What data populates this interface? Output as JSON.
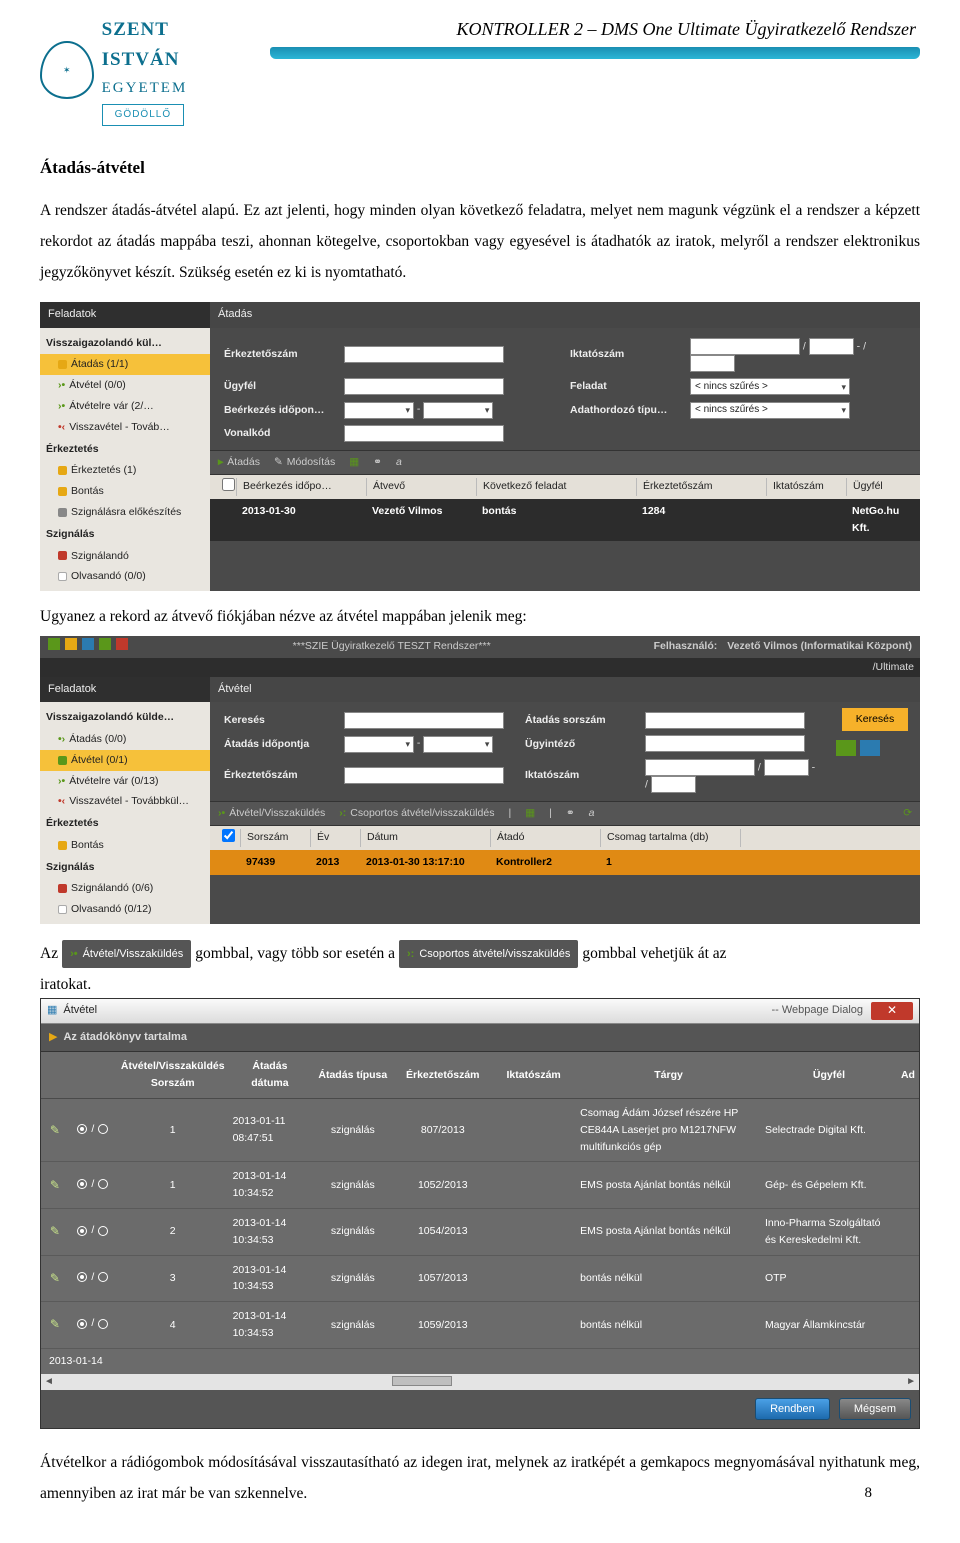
{
  "header": {
    "title": "KONTROLLER 2 – DMS One Ultimate Ügyiratkezelő Rendszer",
    "logo_line1": "SZENT ISTVÁN",
    "logo_line2": "EGYETEM",
    "logo_badge": "GÖDÖLLŐ"
  },
  "section_title": "Átadás-átvétel",
  "para1": "A rendszer átadás-átvétel alapú. Ez azt jelenti, hogy minden olyan következő feladatra, melyet nem magunk végzünk el a rendszer a képzett rekordot az átadás mappába teszi, ahonnan kötegelve, csoportokban vagy egyesével is átadhatók az iratok, melyről a rendszer elektronikus jegyzőkönyvet készít. Szükség esetén ez ki is nyomtatható.",
  "shot1": {
    "left_title": "Feladatok",
    "right_title": "Átadás",
    "sidebar": {
      "grp1": "Visszaigazolandó kül…",
      "items1": [
        {
          "label": "Átadás (1/1)",
          "sel": true,
          "sq": "sq-y"
        },
        {
          "label": "Átvétel (0/0)",
          "mk": "mk-g",
          "pre": ">•"
        },
        {
          "label": "Átvételre vár (2/…",
          "mk": "mk-g",
          "pre": ">•"
        },
        {
          "label": "Visszavétel - Továb…",
          "mk": "mk-r",
          "pre": "•<"
        }
      ],
      "grp2": "Érkeztetés",
      "items2": [
        {
          "label": "Érkeztetés (1)",
          "sq": "sq-y"
        },
        {
          "label": "Bontás",
          "sq": "sq-y"
        },
        {
          "label": "Szignálásra előkészítés",
          "sq": "sq-gr"
        }
      ],
      "grp3": "Szignálás",
      "items3": [
        {
          "label": "Szignálandó",
          "sq": "sq-r"
        },
        {
          "label": "Olvasandó (0/0)",
          "sq": "sq-w"
        }
      ]
    },
    "filters": {
      "erkeztszam": "Érkeztetőszám",
      "iktatoszam": "Iktatószám",
      "ugyfel": "Ügyfél",
      "feladat": "Feladat",
      "feladat_val": "< nincs szűrés >",
      "beerk": "Beérkezés időpon…",
      "adathord": "Adathordozó típu…",
      "adathord_val": "< nincs szűrés >",
      "vonalkod": "Vonalkód"
    },
    "toolbar": {
      "atadas": "Átadás",
      "modositas": "Módosítás"
    },
    "list_head": [
      "",
      "Beérkezés időpo…",
      "Átvevő",
      "Következő feladat",
      "Érkeztetőszám",
      "Iktatószám",
      "Ügyfél"
    ],
    "row": [
      "",
      "2013-01-30",
      "Vezető Vilmos",
      "bontás",
      "1284",
      "",
      "NetGo.hu Kft."
    ]
  },
  "caption1": "Ugyanez a rekord az átvevő fiókjában nézve az átvétel mappában jelenik meg:",
  "shot2": {
    "topbar": {
      "title": "***SZIE Ügyiratkezelő TESZT Rendszer***",
      "user_lbl": "Felhasználó:",
      "user_val": "Vezető Vilmos (Informatikai Központ)",
      "brand": "/Ultimate"
    },
    "left_title": "Feladatok",
    "right_title": "Átvétel",
    "sidebar": {
      "grp1": "Visszaigazolandó külde…",
      "items1": [
        {
          "label": "Átadás (0/0)",
          "mk": "mk-g",
          "pre": "•>"
        },
        {
          "label": "Átvétel (0/1)",
          "sel": true,
          "sq": "sq-g"
        },
        {
          "label": "Átvételre vár (0/13)",
          "mk": "mk-g",
          "pre": ">•"
        },
        {
          "label": "Visszavétel - Továbbkül…",
          "mk": "mk-r",
          "pre": "•<"
        }
      ],
      "grp2": "Érkeztetés",
      "items2": [
        {
          "label": "Bontás",
          "sq": "sq-y"
        }
      ],
      "grp3": "Szignálás",
      "items3": [
        {
          "label": "Szignálandó (0/6)",
          "sq": "sq-r"
        },
        {
          "label": "Olvasandó (0/12)",
          "sq": "sq-w"
        }
      ]
    },
    "filters": {
      "kereses": "Keresés",
      "atsorszam": "Átadás sorszám",
      "kerbtn": "Keresés",
      "atido": "Átadás időpontja",
      "ugyint": "Ügyintéző",
      "erkeztszam": "Érkeztetőszám",
      "iktatoszam": "Iktatószám"
    },
    "toolbar": {
      "t1": "Átvétel/Visszaküldés",
      "t2": "Csoportos átvétel/visszaküldés"
    },
    "list_head": [
      "",
      "Sorszám",
      "Év",
      "Dátum",
      "Átadó",
      "Csomag tartalma (db)",
      ""
    ],
    "row": [
      "",
      "97439",
      "2013",
      "2013-01-30 13:17:10",
      "Kontroller2",
      "1",
      ""
    ]
  },
  "inline": {
    "pre": "Az",
    "btn1": "Átvétel/Visszaküldés",
    "mid": " gombbal, vagy több sor esetén a ",
    "btn2": "Csoportos átvétel/visszaküldés",
    "post": " gombbal vehetjük át az",
    "line2": "iratokat."
  },
  "dialog": {
    "title": "Átvétel",
    "title_suffix": "-- Webpage Dialog",
    "subtitle": "Az átadókönyv tartalma",
    "head": [
      "",
      "",
      "Átvétel/Visszaküldés Sorszám",
      "Átadás dátuma",
      "Átadás típusa",
      "Érkeztetőszám",
      "Iktatószám",
      "Tárgy",
      "Ügyfél",
      "Ad"
    ],
    "rows": [
      {
        "sor": "1",
        "datum": "2013-01-11 08:47:51",
        "tipus": "szignálás",
        "erk": "807/2013",
        "ikt": "",
        "targy": "Csomag Ádám József részére HP CE844A Laserjet pro M1217NFW multifunkciós gép",
        "ugyfel": "Selectrade Digital Kft."
      },
      {
        "sor": "1",
        "datum": "2013-01-14 10:34:52",
        "tipus": "szignálás",
        "erk": "1052/2013",
        "ikt": "",
        "targy": "EMS posta Ajánlat bontás nélkül",
        "ugyfel": "Gép- és Gépelem Kft."
      },
      {
        "sor": "2",
        "datum": "2013-01-14 10:34:53",
        "tipus": "szignálás",
        "erk": "1054/2013",
        "ikt": "",
        "targy": "EMS posta Ajánlat bontás nélkül",
        "ugyfel": "Inno-Pharma Szolgáltató és Kereskedelmi Kft."
      },
      {
        "sor": "3",
        "datum": "2013-01-14 10:34:53",
        "tipus": "szignálás",
        "erk": "1057/2013",
        "ikt": "",
        "targy": "bontás nélkül",
        "ugyfel": "OTP"
      },
      {
        "sor": "4",
        "datum": "2013-01-14 10:34:53",
        "tipus": "szignálás",
        "erk": "1059/2013",
        "ikt": "",
        "targy": "bontás nélkül",
        "ugyfel": "Magyar Államkincstár"
      }
    ],
    "extra_date": "2013-01-14",
    "ok": "Rendben",
    "cancel": "Mégsem"
  },
  "para2": "Átvételkor a rádiógombok módosításával visszautasítható az idegen irat, melynek az iratképét a gemkapocs megnyomásával nyithatunk meg, amennyiben az irat már be van szkennelve.",
  "page_num": "8"
}
